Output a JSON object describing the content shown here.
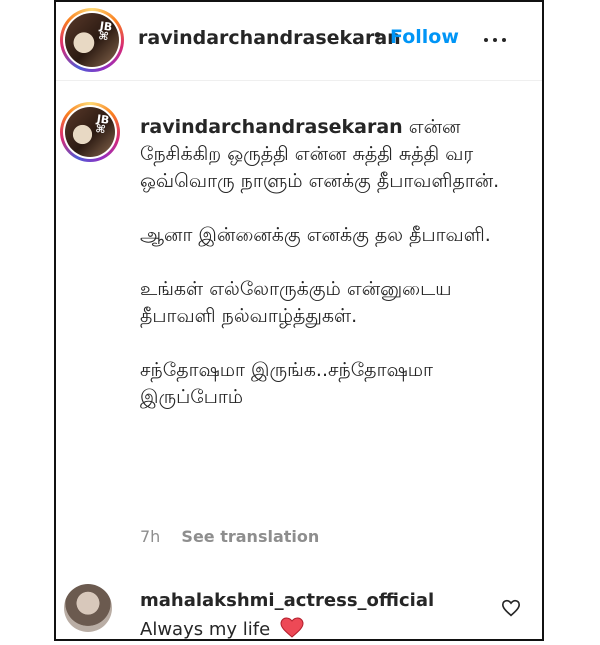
{
  "post": {
    "username": "ravindarchandrasekaran",
    "separator": "•",
    "follow_label": "Follow",
    "more_icon": "more-horizontal-icon"
  },
  "caption": {
    "username": "ravindarchandrasekaran",
    "paragraphs": [
      "என்ன நேசிக்கிற ஒருத்தி என்ன சுத்தி சுத்தி வர ஒவ்வொரு நாளும் எனக்கு தீபாவளிதான்.",
      "ஆனா இன்னைக்கு எனக்கு தல தீபாவளி.",
      "உங்கள் எல்லோருக்கும் என்னுடைய தீபாவளி நல்வாழ்த்துகள்.",
      "சந்தோஷமா இருங்க..சந்தோஷமா இருப்போம்"
    ],
    "time": "7h",
    "translate_label": "See translation"
  },
  "comment": {
    "username": "mahalakshmi_actress_official",
    "text": "Always my life",
    "emoji_icon": "red-heart-icon",
    "like_icon": "heart-outline-icon"
  },
  "colors": {
    "follow": "#0095f6",
    "muted": "#8e8e8e",
    "text": "#262626",
    "heart": "#ed4956"
  }
}
